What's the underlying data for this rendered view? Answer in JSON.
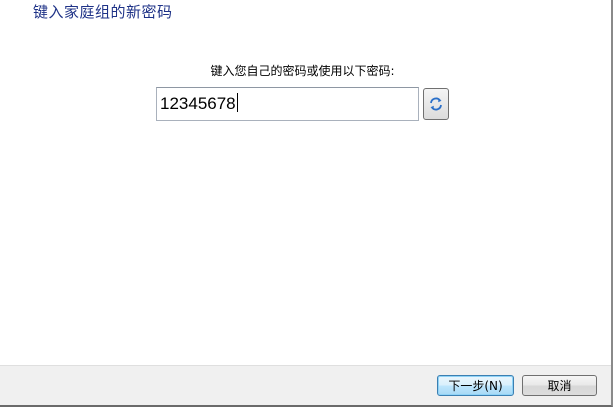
{
  "window": {
    "title": "键入家庭组的新密码"
  },
  "form": {
    "prompt": "键入您自己的密码或使用以下密码:",
    "password_value": "12345678",
    "refresh_icon": "refresh-icon"
  },
  "footer": {
    "next_label": "下一步(N)",
    "cancel_label": "取消"
  },
  "colors": {
    "title_blue": "#1e3287",
    "footer_bg": "#f0f0f0",
    "default_button_border": "#3c7fb1"
  }
}
